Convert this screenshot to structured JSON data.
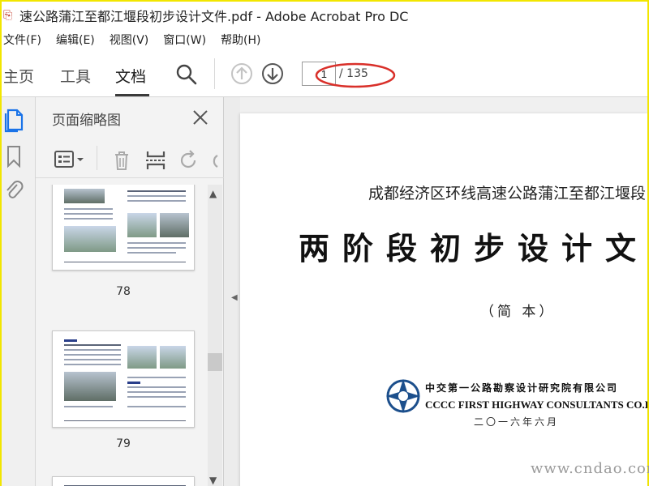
{
  "window": {
    "title": "速公路蒲江至都江堰段初步设计文件.pdf - Adobe Acrobat Pro DC"
  },
  "menu": [
    "文件(F)",
    "编辑(E)",
    "视图(V)",
    "窗口(W)",
    "帮助(H)"
  ],
  "toolbar": {
    "tabs": [
      {
        "label": "主页",
        "active": false
      },
      {
        "label": "工具",
        "active": false
      },
      {
        "label": "文档",
        "active": true
      }
    ],
    "page_number": "1",
    "page_total": "/ 135",
    "icons": [
      "search-icon",
      "prev-page-icon",
      "next-page-icon"
    ]
  },
  "thumbnails_panel": {
    "title": "页面缩略图",
    "pages": [
      {
        "label": "78"
      },
      {
        "label": "79"
      }
    ]
  },
  "document": {
    "subtitle": "成都经济区环线高速公路蒲江至都江堰段",
    "title": "两阶段初步设计文",
    "edition": "（简 本）",
    "company_cn": "中交第一公路勘察设计研究院有限公司",
    "company_en": "CCCC FIRST HIGHWAY CONSULTANTS CO.LTD.",
    "date": "二〇一六年六月"
  },
  "watermark": "www.cndao.com",
  "colors": {
    "annotation": "#d9302a",
    "border": "#f2e600",
    "logo_blue": "#1c4f8c"
  }
}
